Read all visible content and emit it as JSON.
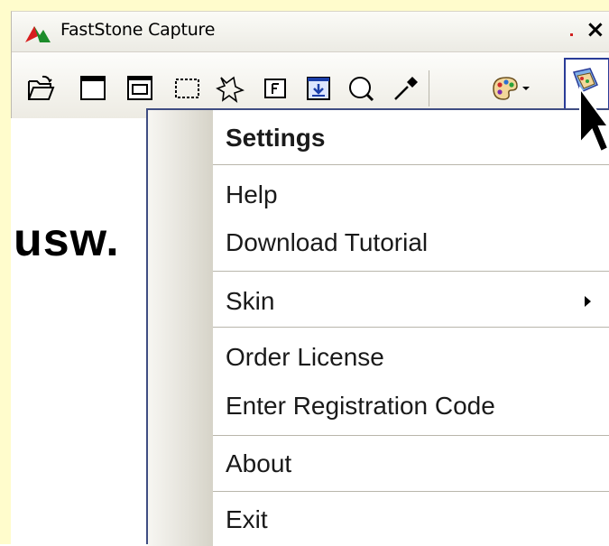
{
  "window": {
    "title": "FastStone Capture",
    "close_glyph": "×",
    "logo_icon": "faststone-logo-icon"
  },
  "toolbar": {
    "buttons": [
      {
        "icon": "open-file-icon"
      },
      {
        "icon": "capture-window-icon"
      },
      {
        "icon": "capture-object-icon"
      },
      {
        "icon": "capture-rectangle-icon"
      },
      {
        "icon": "capture-freehand-icon"
      },
      {
        "icon": "capture-fullscreen-icon"
      },
      {
        "icon": "capture-scrolling-icon"
      },
      {
        "icon": "magnifier-icon"
      },
      {
        "icon": "color-picker-icon"
      },
      {
        "icon": "output-palette-icon"
      },
      {
        "icon": "settings-menu-icon"
      }
    ]
  },
  "overlay_text": "usw.",
  "menu": {
    "items": [
      {
        "label": "Settings",
        "bold": true
      },
      {
        "label": "Help"
      },
      {
        "label": "Download Tutorial"
      },
      {
        "label": "Skin",
        "submenu": true
      },
      {
        "label": "Order License"
      },
      {
        "label": "Enter Registration Code"
      },
      {
        "label": "About"
      },
      {
        "label": "Exit"
      }
    ]
  },
  "colors": {
    "background_left": "#fffccc",
    "menu_border": "#3f4d82",
    "active_button_border": "#2a3c98"
  }
}
